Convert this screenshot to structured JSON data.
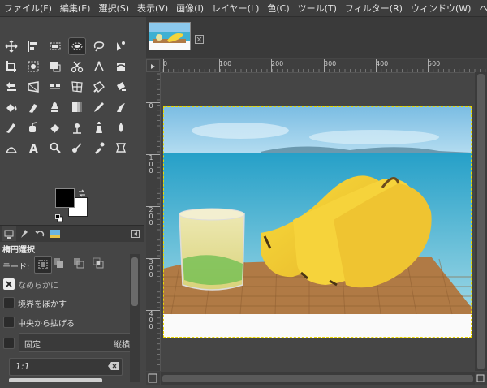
{
  "menu": [
    "ファイル(F)",
    "編集(E)",
    "選択(S)",
    "表示(V)",
    "画像(I)",
    "レイヤー(L)",
    "色(C)",
    "ツール(T)",
    "フィルター(R)",
    "ウィンドウ(W)",
    "ヘルプ(H)"
  ],
  "toolbox": {
    "tool_icons": [
      "move-icon",
      "align-icon",
      "rect-select-icon",
      "ellipse-select-icon",
      "free-select-icon",
      "fuzzy-select-icon",
      "crop-icon",
      "color-select-icon",
      "unified-transform-icon",
      "scissors-icon",
      "paths-icon",
      "warp-icon",
      "flip-icon",
      "perspective-icon",
      "cage-icon",
      "grid-transform-icon",
      "handle-transform-icon",
      "heal-icon",
      "bucket-fill-icon",
      "brush-icon",
      "clone-icon",
      "blend-icon",
      "pencil-icon",
      "smudge-icon",
      "ink-icon",
      "airbrush-icon",
      "eraser-icon",
      "dodge-icon",
      "mypaint-icon",
      "blur-icon",
      "measure-icon",
      "text-icon",
      "zoom-icon",
      "gradient-icon",
      "color-picker-icon",
      "paint-select-icon"
    ],
    "active_tool": "ellipse-select-icon",
    "fg_color": "#000000",
    "bg_color": "#ffffff"
  },
  "tool_options": {
    "title": "楕円選択",
    "mode_label": "モード:",
    "antialias_label": "なめらかに",
    "feather_label": "境界をぼかす",
    "expand_center_label": "中央から拡げる",
    "fixed_label": "固定",
    "fixed_value": "縦横",
    "ratio_value": "1:1"
  },
  "canvas": {
    "ruler_h_labels": [
      "0",
      "100",
      "200",
      "300",
      "400",
      "500"
    ],
    "ruler_v_labels": [
      "0",
      "100",
      "200",
      "300",
      "400"
    ],
    "colors": {
      "sky": "#89c7e8",
      "sea": "#2aa7c9",
      "banana": "#f5d43a",
      "mat": "#b07a45"
    }
  }
}
